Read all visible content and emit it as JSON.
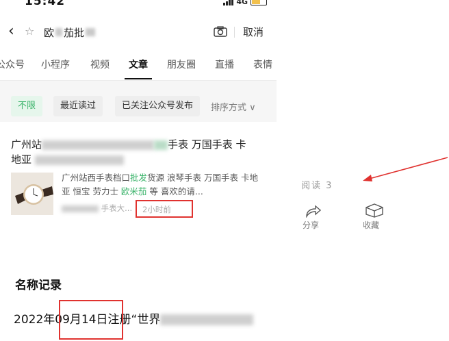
{
  "status_bar": {
    "time": "15:42",
    "network": "4G"
  },
  "search": {
    "query_start": "欧",
    "query_mid": "茄批",
    "cancel_label": "取消"
  },
  "tabs": [
    {
      "label": "公众号"
    },
    {
      "label": "小程序"
    },
    {
      "label": "视频"
    },
    {
      "label": "文章",
      "active": true
    },
    {
      "label": "朋友圈"
    },
    {
      "label": "直播"
    },
    {
      "label": "表情"
    }
  ],
  "filters": {
    "chips": [
      {
        "label": "不限",
        "active": true
      },
      {
        "label": "最近读过"
      },
      {
        "label": "已关注公众号发布"
      }
    ],
    "sort_label": "排序方式"
  },
  "result": {
    "title_start": "广州站",
    "title_part2": "手表 万国手表 卡",
    "title_line2_start": "地亚",
    "snippet_part1": "广州站西手表档口",
    "snippet_hl1": "批发",
    "snippet_part2": "货源 浪琴手表 万国手表 卡地亚 恒宝 劳力士 ",
    "snippet_hl2": "欧米茄",
    "snippet_part3": " 等 喜欢的请...",
    "meta_source": "手表大...",
    "time_ago": "2小时前"
  },
  "article_actions": {
    "read_label": "阅读 3",
    "share_label": "分享",
    "favorite_label": "收藏"
  },
  "record": {
    "section_title": "名称记录",
    "year": "2022年",
    "date": "09月14日",
    "text": "注册“世界"
  },
  "colors": {
    "accent_green": "#3ab36a",
    "highlight_red": "#e0322f"
  }
}
